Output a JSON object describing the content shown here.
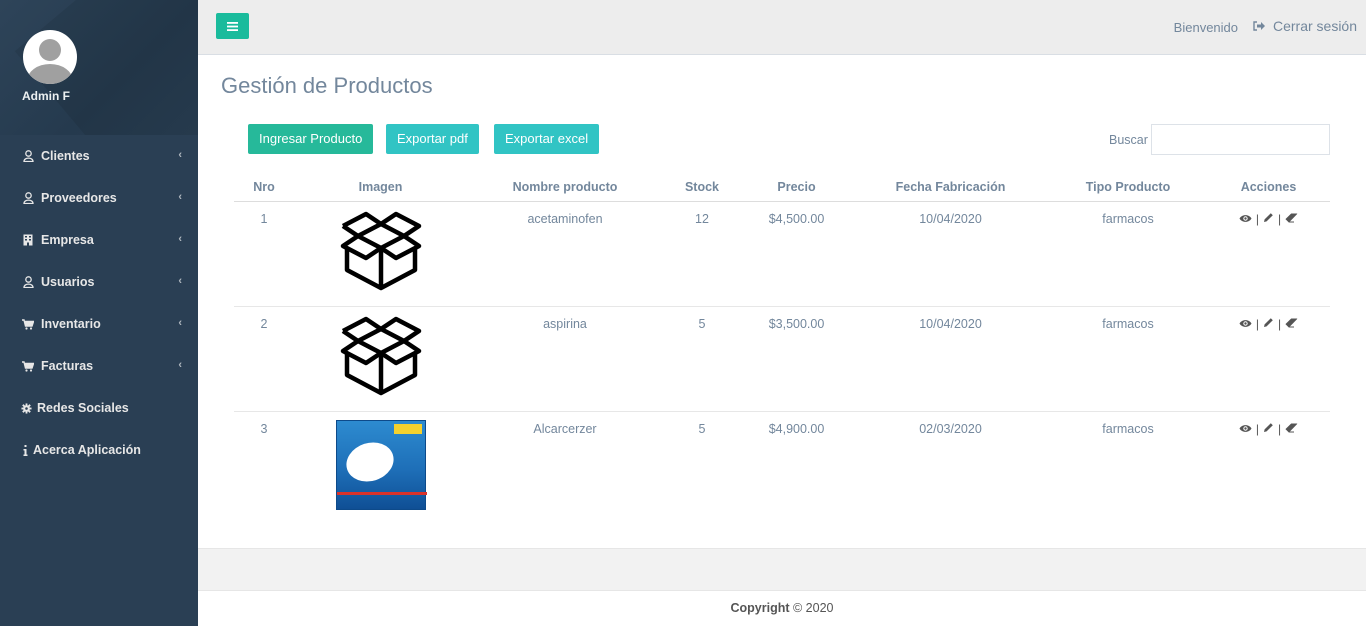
{
  "sidebar": {
    "user_name": "Admin F",
    "items": [
      {
        "label": "Clientes",
        "icon": "user-icon",
        "has_submenu": true
      },
      {
        "label": "Proveedores",
        "icon": "user-icon",
        "has_submenu": true
      },
      {
        "label": "Empresa",
        "icon": "building-icon",
        "has_submenu": true
      },
      {
        "label": "Usuarios",
        "icon": "user-icon",
        "has_submenu": true
      },
      {
        "label": "Inventario",
        "icon": "cart-icon",
        "has_submenu": true
      },
      {
        "label": "Facturas",
        "icon": "cart-icon",
        "has_submenu": true
      },
      {
        "label": "Redes Sociales",
        "icon": "gear-icon",
        "has_submenu": false
      },
      {
        "label": "Acerca Aplicación",
        "icon": "info-icon",
        "has_submenu": false
      }
    ]
  },
  "topbar": {
    "welcome": "Bienvenido",
    "logout": "Cerrar sesión"
  },
  "main": {
    "title": "Gestión de Productos",
    "buttons": {
      "add": "Ingresar Producto",
      "pdf": "Exportar pdf",
      "excel": "Exportar excel"
    },
    "search_label": "Buscar",
    "search_value": "",
    "table": {
      "headers": [
        "Nro",
        "Imagen",
        "Nombre producto",
        "Stock",
        "Precio",
        "Fecha Fabricación",
        "Tipo Producto",
        "Acciones"
      ],
      "rows": [
        {
          "nro": "1",
          "image": "box-icon",
          "name": "acetaminofen",
          "stock": "12",
          "price": "$4,500.00",
          "date": "10/04/2020",
          "type": "farmacos"
        },
        {
          "nro": "2",
          "image": "box-icon",
          "name": "aspirina",
          "stock": "5",
          "price": "$3,500.00",
          "date": "10/04/2020",
          "type": "farmacos"
        },
        {
          "nro": "3",
          "image": "product-photo",
          "name": "Alcarcerzer",
          "stock": "5",
          "price": "$4,900.00",
          "date": "02/03/2020",
          "type": "farmacos"
        }
      ]
    }
  },
  "footer": {
    "bold": "Copyright",
    "rest": " © 2020"
  },
  "colors": {
    "sidebar_bg": "#2a3f54",
    "accent_green": "#26b99a",
    "accent_cyan": "#31c4c4",
    "text": "#73879c"
  }
}
